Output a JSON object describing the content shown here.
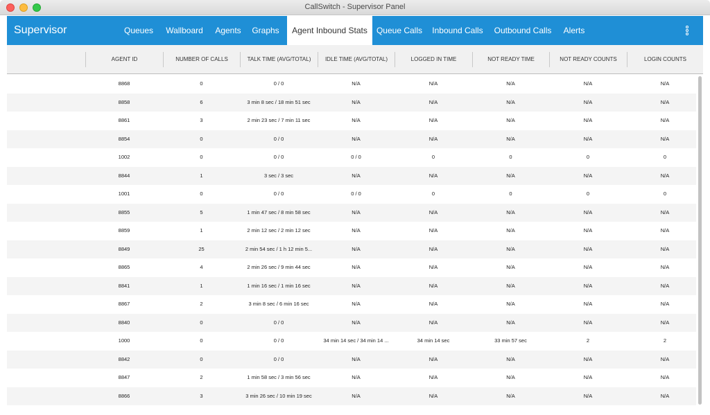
{
  "window": {
    "title": "CallSwitch - Supervisor Panel"
  },
  "navbar": {
    "brand": "Supervisor",
    "tabs": [
      {
        "label": "Queues"
      },
      {
        "label": "Wallboard"
      },
      {
        "label": "Agents"
      },
      {
        "label": "Graphs"
      },
      {
        "label": "Agent Inbound Stats",
        "active": true
      },
      {
        "label": "Queue Calls"
      },
      {
        "label": "Inbound Calls"
      },
      {
        "label": "Outbound Calls"
      },
      {
        "label": "Alerts"
      }
    ],
    "menu_icon": "more-vertical-icon"
  },
  "table": {
    "columns": [
      "AGENT ID",
      "NUMBER OF CALLS",
      "TALK TIME (AVG/TOTAL)",
      "IDLE TIME (AVG/TOTAL)",
      "LOGGED IN TIME",
      "NOT READY TIME",
      "NOT READY COUNTS",
      "LOGIN COUNTS"
    ],
    "rows": [
      [
        "8868",
        "0",
        "0 / 0",
        "N/A",
        "N/A",
        "N/A",
        "N/A",
        "N/A"
      ],
      [
        "8858",
        "6",
        "3 min 8 sec / 18 min 51 sec",
        "N/A",
        "N/A",
        "N/A",
        "N/A",
        "N/A"
      ],
      [
        "8861",
        "3",
        "2 min 23 sec / 7 min 11 sec",
        "N/A",
        "N/A",
        "N/A",
        "N/A",
        "N/A"
      ],
      [
        "8854",
        "0",
        "0 / 0",
        "N/A",
        "N/A",
        "N/A",
        "N/A",
        "N/A"
      ],
      [
        "1002",
        "0",
        "0 / 0",
        "0 / 0",
        "0",
        "0",
        "0",
        "0"
      ],
      [
        "8844",
        "1",
        "3 sec / 3 sec",
        "N/A",
        "N/A",
        "N/A",
        "N/A",
        "N/A"
      ],
      [
        "1001",
        "0",
        "0 / 0",
        "0 / 0",
        "0",
        "0",
        "0",
        "0"
      ],
      [
        "8855",
        "5",
        "1 min 47 sec / 8 min 58 sec",
        "N/A",
        "N/A",
        "N/A",
        "N/A",
        "N/A"
      ],
      [
        "8859",
        "1",
        "2 min 12 sec / 2 min 12 sec",
        "N/A",
        "N/A",
        "N/A",
        "N/A",
        "N/A"
      ],
      [
        "8849",
        "25",
        "2 min 54 sec / 1 h 12 min 5...",
        "N/A",
        "N/A",
        "N/A",
        "N/A",
        "N/A"
      ],
      [
        "8865",
        "4",
        "2 min 26 sec / 9 min 44 sec",
        "N/A",
        "N/A",
        "N/A",
        "N/A",
        "N/A"
      ],
      [
        "8841",
        "1",
        "1 min 16 sec / 1 min 16 sec",
        "N/A",
        "N/A",
        "N/A",
        "N/A",
        "N/A"
      ],
      [
        "8867",
        "2",
        "3 min 8 sec / 6 min 16 sec",
        "N/A",
        "N/A",
        "N/A",
        "N/A",
        "N/A"
      ],
      [
        "8840",
        "0",
        "0 / 0",
        "N/A",
        "N/A",
        "N/A",
        "N/A",
        "N/A"
      ],
      [
        "1000",
        "0",
        "0 / 0",
        "34 min 14 sec / 34 min 14 ...",
        "34 min 14 sec",
        "33 min 57 sec",
        "2",
        "2"
      ],
      [
        "8842",
        "0",
        "0 / 0",
        "N/A",
        "N/A",
        "N/A",
        "N/A",
        "N/A"
      ],
      [
        "8847",
        "2",
        "1 min 58 sec / 3 min 56 sec",
        "N/A",
        "N/A",
        "N/A",
        "N/A",
        "N/A"
      ],
      [
        "8866",
        "3",
        "3 min 26 sec / 10 min 19 sec",
        "N/A",
        "N/A",
        "N/A",
        "N/A",
        "N/A"
      ]
    ]
  }
}
